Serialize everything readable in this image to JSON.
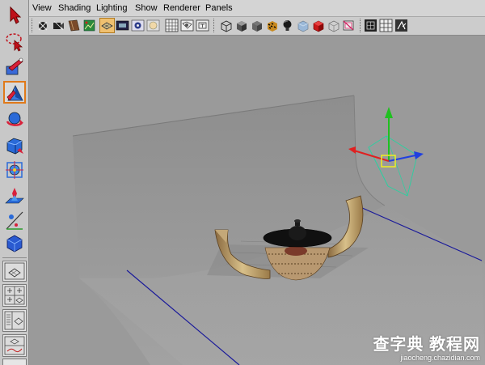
{
  "menubar": {
    "items": [
      "View",
      "Shading",
      "Lighting",
      "Show",
      "Renderer",
      "Panels"
    ]
  },
  "toolbox": {
    "tools": [
      {
        "icon": "select-arrow-icon",
        "active": false
      },
      {
        "icon": "lasso-select-icon",
        "active": false
      },
      {
        "icon": "paint-select-icon",
        "active": false
      },
      {
        "icon": "move-tool-icon",
        "active": true
      },
      {
        "icon": "rotate-tool-icon",
        "active": false
      },
      {
        "icon": "scale-tool-icon",
        "active": false
      },
      {
        "icon": "universal-manipulator-icon",
        "active": false
      },
      {
        "icon": "soft-modification-icon",
        "active": false
      },
      {
        "icon": "show-manipulator-icon",
        "active": false
      },
      {
        "icon": "last-tool-icon",
        "active": false
      }
    ],
    "accent": "#e07a1a"
  },
  "iconbar": {
    "icons": [
      "select-camera-icon",
      "camera-attributes-icon",
      "bookmarks-icon",
      "image-plane-icon",
      "grid-icon",
      "film-gate-icon",
      "resolution-gate-icon",
      "gate-mask-icon",
      "field-chart-icon",
      "safe-action-icon",
      "safe-title-icon",
      "wireframe-icon",
      "smooth-shade-icon",
      "flat-shade-icon",
      "textured-icon",
      "use-all-lights-icon",
      "shadows-icon",
      "xray-icon",
      "xray-joints-icon",
      "backface-culling-icon",
      "isolate-select-icon",
      "high-quality-icon",
      "render-view-icon"
    ],
    "selected_index": 4
  },
  "viewport": {
    "background": "#9a9a9a",
    "backdrop_color": "#9b9b9b",
    "manipulator_colors": {
      "y": "#20c020",
      "x": "#e02020",
      "z": "#2040e0",
      "center": "#f0f020"
    }
  },
  "watermark": {
    "title": "查字典 教程网",
    "url": "jiaocheng.chazidian.com"
  }
}
